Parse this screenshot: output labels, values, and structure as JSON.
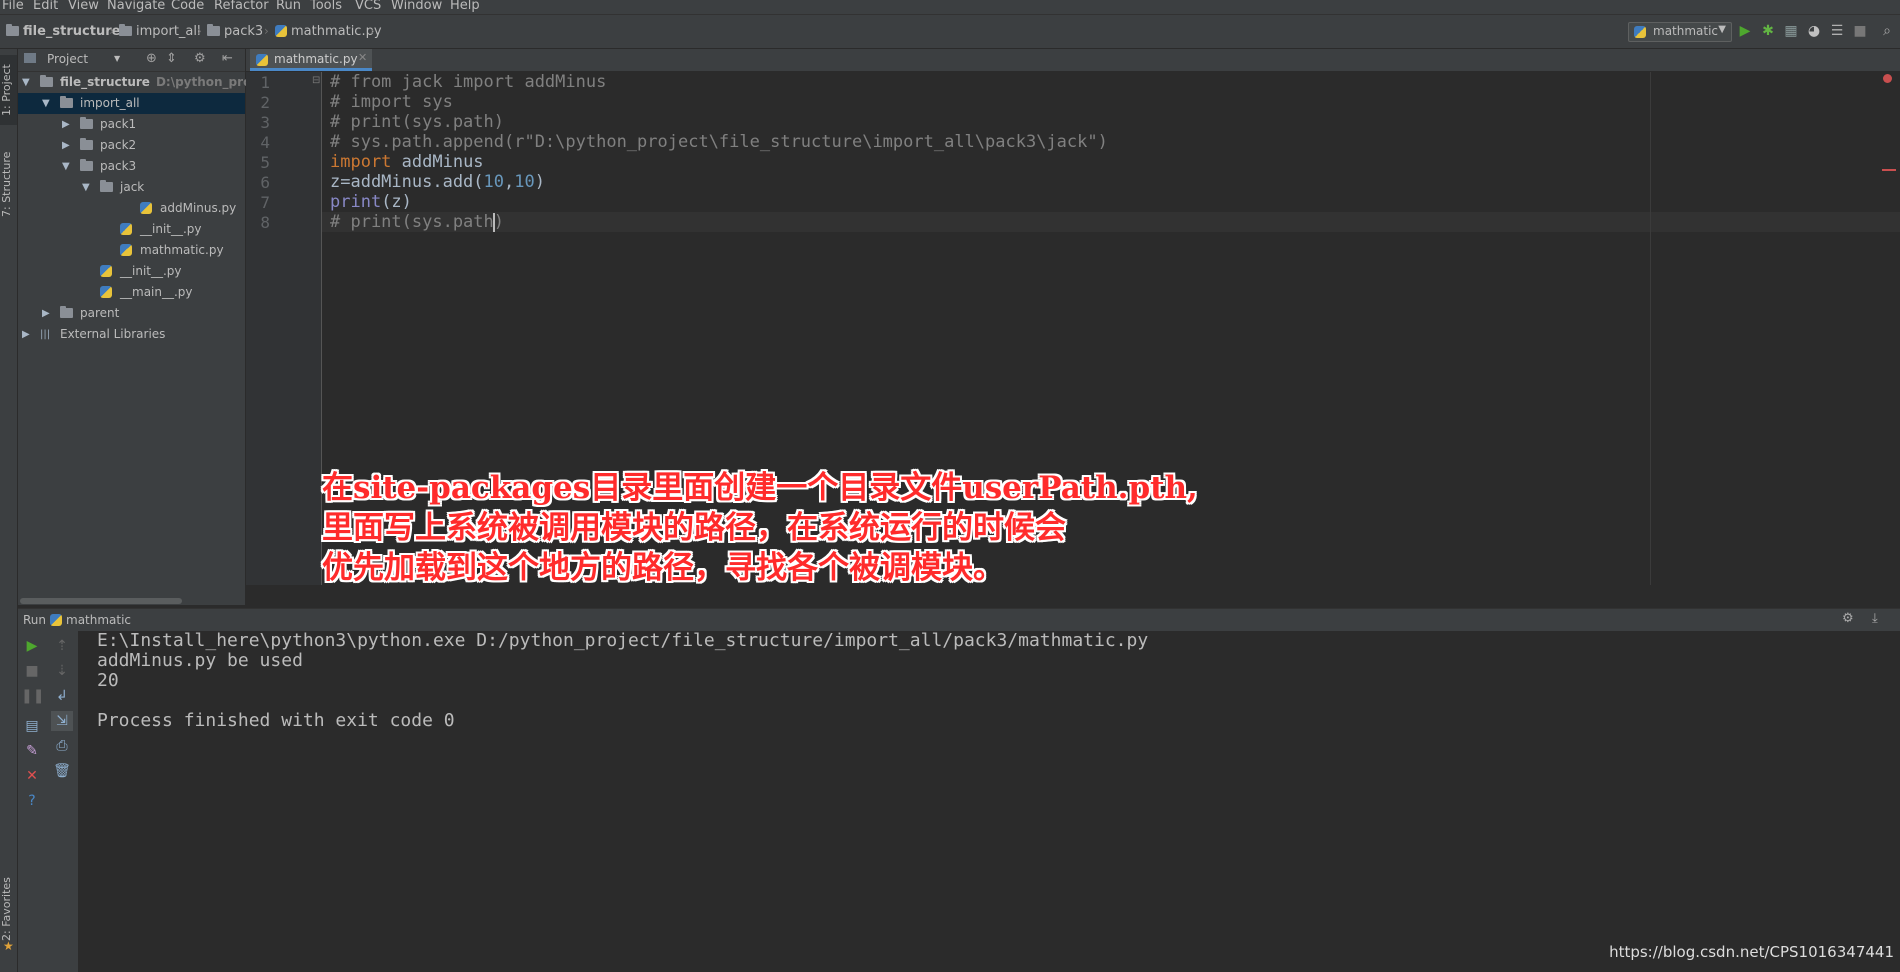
{
  "menu": [
    "File",
    "Edit",
    "View",
    "Navigate",
    "Code",
    "Refactor",
    "Run",
    "Tools",
    "VCS",
    "Window",
    "Help"
  ],
  "breadcrumb": [
    "file_structure",
    "import_all",
    "pack3",
    "mathmatic.py"
  ],
  "run_config": "mathmatic",
  "left_stripe": {
    "project_tab": "1: Project",
    "structure_tab": "7: Structure",
    "favorites_tab": "2: Favorites"
  },
  "project": {
    "header": "Project",
    "tree": [
      {
        "label": "file_structure",
        "extra": "D:\\python_projec",
        "type": "folder",
        "depth": 0,
        "expanded": true,
        "bold": true
      },
      {
        "label": "import_all",
        "type": "folder",
        "depth": 1,
        "expanded": true,
        "selected": true
      },
      {
        "label": "pack1",
        "type": "folder",
        "depth": 2,
        "expanded": false
      },
      {
        "label": "pack2",
        "type": "folder",
        "depth": 2,
        "expanded": false
      },
      {
        "label": "pack3",
        "type": "folder",
        "depth": 2,
        "expanded": true
      },
      {
        "label": "jack",
        "type": "folder",
        "depth": 3,
        "expanded": true
      },
      {
        "label": "addMinus.py",
        "type": "py",
        "depth": 5
      },
      {
        "label": "__init__.py",
        "type": "py",
        "depth": 4
      },
      {
        "label": "mathmatic.py",
        "type": "py",
        "depth": 4
      },
      {
        "label": "__init__.py",
        "type": "py",
        "depth": 3
      },
      {
        "label": "__main__.py",
        "type": "py",
        "depth": 3
      },
      {
        "label": "parent",
        "type": "folder",
        "depth": 1,
        "expanded": false
      },
      {
        "label": "External Libraries",
        "type": "lib",
        "depth": 0,
        "expanded": false
      }
    ]
  },
  "editor": {
    "tab": "mathmatic.py",
    "line_numbers": [
      "1",
      "2",
      "3",
      "4",
      "5",
      "6",
      "7",
      "8"
    ],
    "lines": [
      "# from jack import addMinus",
      "# import sys",
      "# print(sys.path)",
      "# sys.path.append(r\"D:\\python_project\\file_structure\\import_all\\pack3\\jack\")",
      "import addMinus",
      "z=addMinus.add(10,10)",
      "print(z)",
      "# print(sys.path)"
    ],
    "annotation": "在site-packages目录里面创建一个目录文件userPath.pth,\n里面写上系统被调用模块的路径，在系统运行的时候会\n优先加载到这个地方的路径，寻找各个被调模块。"
  },
  "run": {
    "label": "Run",
    "config": "mathmatic",
    "output": [
      "E:\\Install_here\\python3\\python.exe D:/python_project/file_structure/import_all/pack3/mathmatic.py",
      "addMinus.py be used",
      "20",
      "",
      "Process finished with exit code 0"
    ]
  },
  "watermark": "https://blog.csdn.net/CPS1016347441"
}
